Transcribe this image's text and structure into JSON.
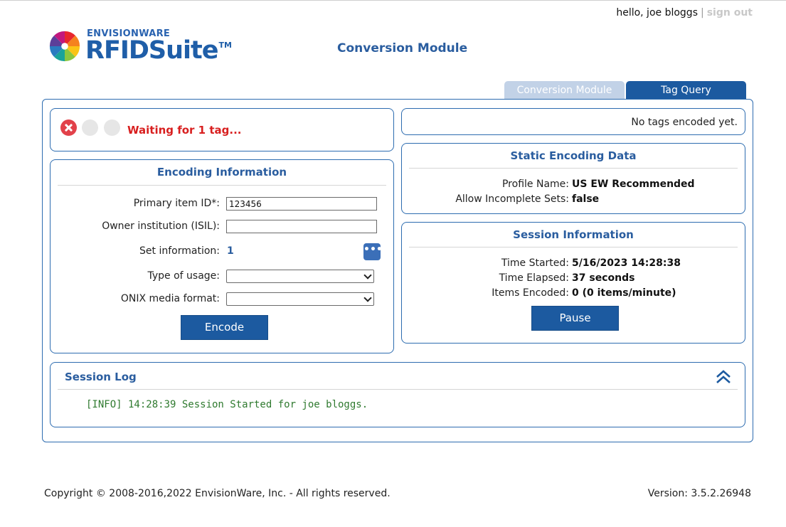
{
  "user_bar": {
    "greeting": "hello, joe bloggs",
    "separator": "|",
    "sign_out": "sign out"
  },
  "logo": {
    "brand_small": "ENVISIONWARE",
    "brand_big": "RFIDSuite",
    "trademark": "TM",
    "mark_icon": "pinwheel-logo-icon"
  },
  "header": {
    "title": "Conversion Module"
  },
  "tabs": [
    {
      "label": "Conversion Module",
      "active": false
    },
    {
      "label": "Tag Query",
      "active": true
    }
  ],
  "status": {
    "lights": [
      "red",
      "gray",
      "gray"
    ],
    "message": "Waiting for 1 tag..."
  },
  "encoding": {
    "title": "Encoding Information",
    "fields": {
      "primary_id_label": "Primary item ID*:",
      "primary_id_value": "123456",
      "owner_label": "Owner institution (ISIL):",
      "owner_value": "",
      "set_label": "Set information:",
      "set_value": "1",
      "set_button": "•••",
      "usage_label": "Type of usage:",
      "usage_value": "",
      "onix_label": "ONIX media format:",
      "onix_value": ""
    },
    "encode_button": "Encode"
  },
  "tags": {
    "message": "No tags encoded yet."
  },
  "static_data": {
    "title": "Static Encoding Data",
    "profile_label": "Profile Name:",
    "profile_value": "US EW Recommended",
    "incomplete_label": "Allow Incomplete Sets:",
    "incomplete_value": "false"
  },
  "session": {
    "title": "Session Information",
    "started_label": "Time Started:",
    "started_value": "5/16/2023 14:28:38",
    "elapsed_label": "Time Elapsed:",
    "elapsed_value": "37 seconds",
    "items_label": "Items Encoded:",
    "items_value": "0 (0 items/minute)",
    "pause_button": "Pause"
  },
  "log": {
    "title": "Session Log",
    "lines": [
      "[INFO] 14:28:39 Session Started for joe bloggs."
    ]
  },
  "footer": {
    "copyright": "Copyright © 2008-2016,2022 EnvisionWare, Inc. - All rights reserved.",
    "version": "Version: 3.5.2.26948"
  },
  "colors": {
    "accent": "#1c5aa0",
    "heading": "#2a5d9f",
    "error": "#d81f1f",
    "log_text": "#2f7a2f",
    "tab_inactive": "#c2d2e7"
  }
}
